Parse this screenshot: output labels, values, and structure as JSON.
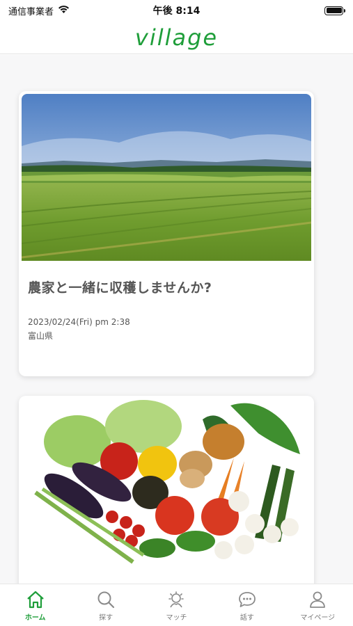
{
  "status_bar": {
    "carrier": "通信事業者",
    "time": "午後 8:14"
  },
  "header": {
    "logo": "village"
  },
  "colors": {
    "brand_green": "#1f9e3a",
    "inactive_icon": "#8a8a8a"
  },
  "cards": [
    {
      "title": "農家と一緒に収穫しませんか?",
      "date": "2023/02/24(Fri) pm 2:38",
      "location": "富山県",
      "image": "wheat-field-photo"
    },
    {
      "image": "vegetables-photo"
    }
  ],
  "tab_bar": {
    "items": [
      {
        "label": "ホーム",
        "icon": "home-icon",
        "active": true
      },
      {
        "label": "探す",
        "icon": "search-icon",
        "active": false
      },
      {
        "label": "マッチ",
        "icon": "match-icon",
        "active": false
      },
      {
        "label": "話す",
        "icon": "chat-icon",
        "active": false
      },
      {
        "label": "マイページ",
        "icon": "person-icon",
        "active": false
      }
    ]
  }
}
